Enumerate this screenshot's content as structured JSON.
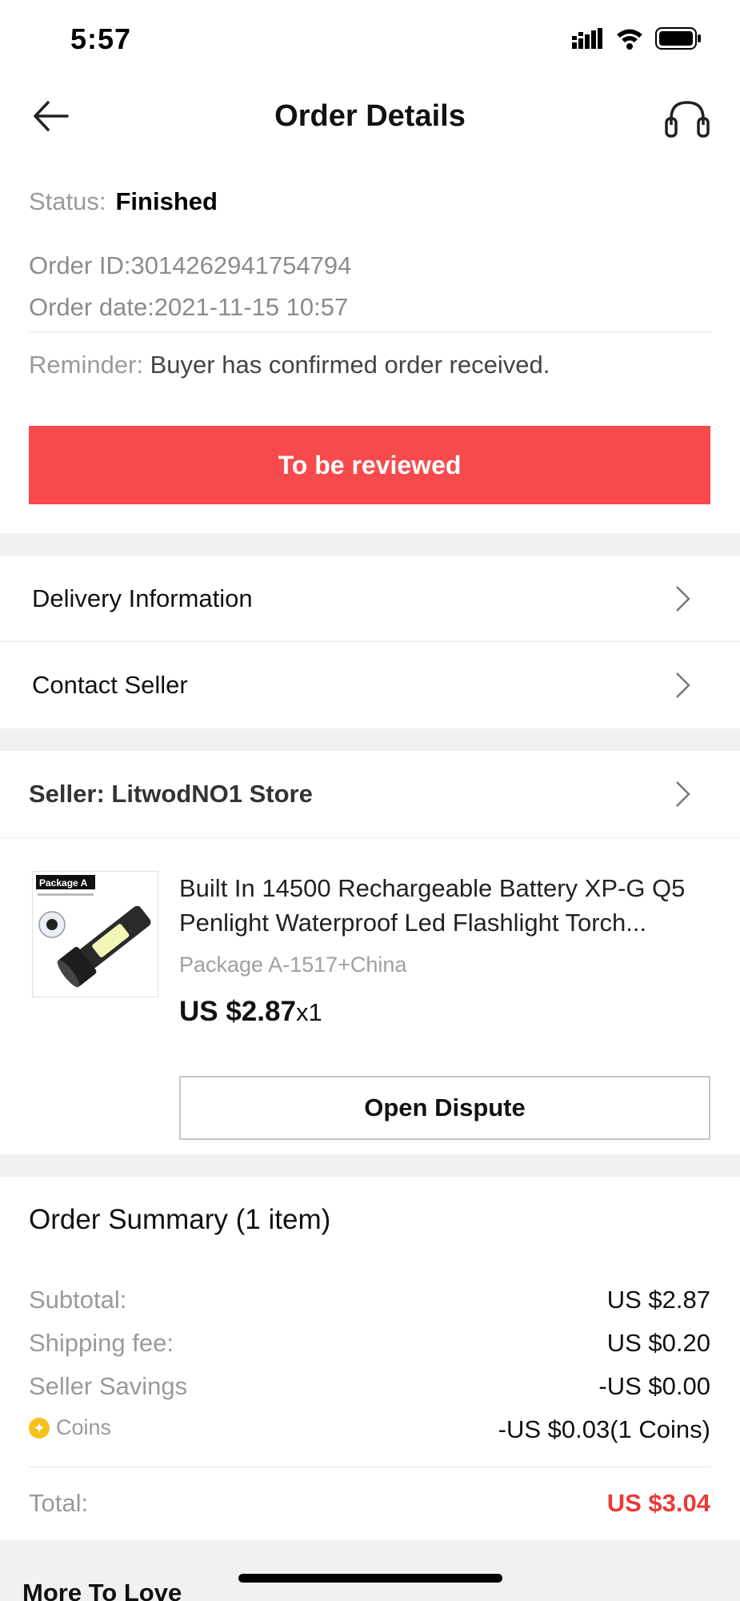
{
  "status_bar": {
    "time": "5:57"
  },
  "header": {
    "title": "Order Details"
  },
  "order": {
    "status_label": "Status:",
    "status_value": "Finished",
    "order_id": "Order ID:3014262941754794",
    "order_date": "Order date:2021-11-15 10:57",
    "reminder_label": "Reminder:",
    "reminder_value": "Buyer has confirmed order received.",
    "review_button": "To be reviewed"
  },
  "links": {
    "delivery": "Delivery Information",
    "contact": "Contact Seller"
  },
  "seller": {
    "label": "Seller: LitwodNO1 Store"
  },
  "product": {
    "thumb_badge": "Package A",
    "title_line1": "Built In 14500 Rechargeable Battery XP-G Q5",
    "title_line2": "Penlight Waterproof Led Flashlight Torch...",
    "variant": "Package A-1517+China",
    "price": "US $2.87",
    "qty": "x1",
    "dispute_button": "Open Dispute"
  },
  "summary": {
    "title": "Order Summary (1 item)",
    "subtotal_label": "Subtotal:",
    "subtotal_value": "US $2.87",
    "shipping_label": "Shipping fee:",
    "shipping_value": "US $0.20",
    "savings_label": "Seller Savings",
    "savings_value": "-US $0.00",
    "coins_label": "Coins",
    "coins_value": "-US $0.03(1 Coins)",
    "total_label": "Total:",
    "total_value": "US $3.04"
  },
  "more": {
    "title": "More To Love"
  },
  "colors": {
    "accent": "#f74a4d",
    "total": "#e83b35",
    "coin": "#f7c21a"
  }
}
